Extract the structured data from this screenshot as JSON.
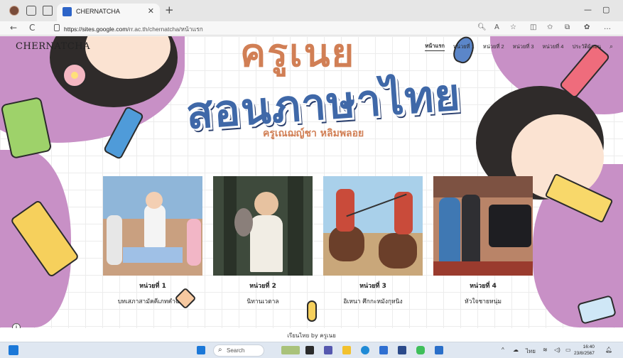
{
  "browser": {
    "tab_title": "CHERNATCHA",
    "tab_close": "✕",
    "new_tab": "+",
    "url_host": "https://sites.google.com",
    "url_path": "/rr.ac.th/chernatcha/หน้าแรก",
    "minimize": "—",
    "restore": "▢",
    "back": "←",
    "reload": "C",
    "icons": [
      "profile-avatar-icon",
      "workspaces-icon",
      "tab-actions-icon",
      "zoom-icon",
      "read-aloud-icon",
      "favorite-icon",
      "split-screen-icon",
      "favorites-icon",
      "collections-icon",
      "extensions-icon",
      "more-icon"
    ]
  },
  "site": {
    "title": "CHERNATCHA",
    "nav": [
      {
        "label": "หน้าแรก",
        "active": true
      },
      {
        "label": "หน่วยที่ 1",
        "active": false
      },
      {
        "label": "หน่วยที่ 2",
        "active": false
      },
      {
        "label": "หน่วยที่ 3",
        "active": false
      },
      {
        "label": "หน่วยที่ 4",
        "active": false
      },
      {
        "label": "ประวัติผู้สอน",
        "active": false
      }
    ]
  },
  "banner": {
    "line1": "ครูเนย",
    "line2": "สอนภาษาไทย",
    "subtitle": "ครูเณฌญ์ชา หลิมพลอย"
  },
  "units": [
    {
      "label": "หน่วยที่ 1",
      "title": "บทเสภาสามัคคีเภทคำฉันท์"
    },
    {
      "label": "หน่วยที่ 2",
      "title": "นิทานเวตาล"
    },
    {
      "label": "หน่วยที่ 3",
      "title": "อิเหนา ศึกกะหมังกุหนิง"
    },
    {
      "label": "หน่วยที่ 4",
      "title": "หัวใจชายหนุ่ม"
    }
  ],
  "footer": {
    "text": "เรียนไทย by ครูเนย",
    "info": "i"
  },
  "taskbar": {
    "search_placeholder": "Search",
    "time": "16:40",
    "date": "23/8/2567",
    "language": "ไทย"
  },
  "colors": {
    "accent_pink": "#c890c6",
    "title_orange": "#d17f55",
    "title_blue": "#3f68a8"
  }
}
